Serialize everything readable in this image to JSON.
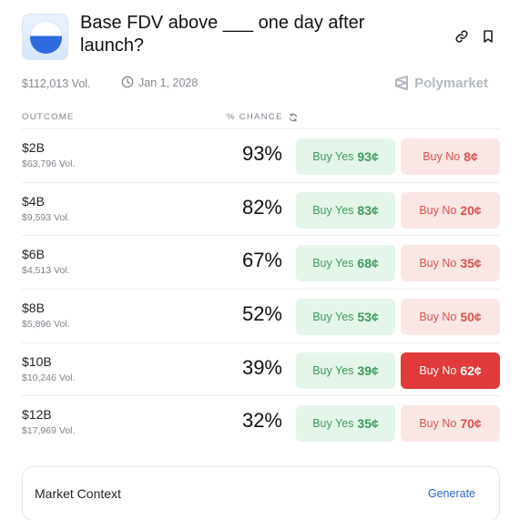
{
  "market": {
    "title": "Base FDV above ___ one day after launch?",
    "volume": "$112,013 Vol.",
    "end_date": "Jan 1, 2028",
    "brand": "Polymarket"
  },
  "icons": {
    "link": "link-icon",
    "bookmark": "bookmark-icon",
    "clock": "clock-icon",
    "refresh": "refresh-icon",
    "brand_logo": "polymarket-logo-icon"
  },
  "table": {
    "outcome_header": "OUTCOME",
    "chance_header": "% CHANCE",
    "rows": [
      {
        "label": "$2B",
        "volume": "$63,796 Vol.",
        "chance": "93%",
        "yes_text": "Buy Yes",
        "yes_price": "93¢",
        "no_text": "Buy No",
        "no_price": "8¢"
      },
      {
        "label": "$4B",
        "volume": "$9,593 Vol.",
        "chance": "82%",
        "yes_text": "Buy Yes",
        "yes_price": "83¢",
        "no_text": "Buy No",
        "no_price": "20¢"
      },
      {
        "label": "$6B",
        "volume": "$4,513 Vol.",
        "chance": "67%",
        "yes_text": "Buy Yes",
        "yes_price": "68¢",
        "no_text": "Buy No",
        "no_price": "35¢"
      },
      {
        "label": "$8B",
        "volume": "$5,896 Vol.",
        "chance": "52%",
        "yes_text": "Buy Yes",
        "yes_price": "53¢",
        "no_text": "Buy No",
        "no_price": "50¢"
      },
      {
        "label": "$10B",
        "volume": "$10,246 Vol.",
        "chance": "39%",
        "yes_text": "Buy Yes",
        "yes_price": "39¢",
        "no_text": "Buy No",
        "no_price": "62¢"
      },
      {
        "label": "$12B",
        "volume": "$17,969 Vol.",
        "chance": "32%",
        "yes_text": "Buy Yes",
        "yes_price": "35¢",
        "no_text": "Buy No",
        "no_price": "70¢"
      }
    ]
  },
  "context": {
    "title": "Market Context",
    "action": "Generate"
  },
  "colors": {
    "yes_bg": "#e4f5e9",
    "yes_text": "#3e9a5e",
    "no_bg": "#fbe6e6",
    "no_text": "#d9534f",
    "no_active_bg": "#e03a3a",
    "link": "#2b63c9"
  }
}
